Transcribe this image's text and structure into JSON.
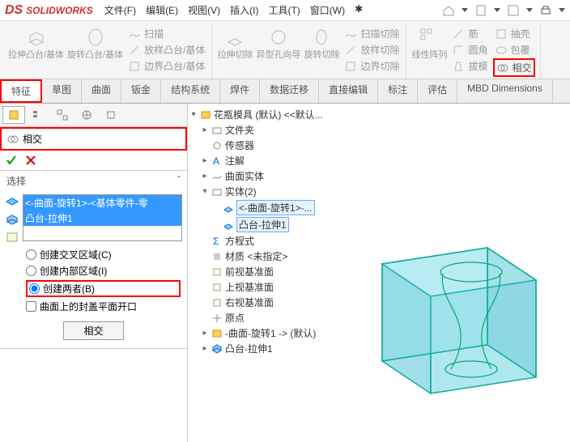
{
  "app": {
    "name": "SOLIDWORKS"
  },
  "menu": [
    "文件(F)",
    "编辑(E)",
    "视图(V)",
    "插入(I)",
    "工具(T)",
    "窗口(W)"
  ],
  "ribbon": {
    "group1_big": [
      "拉伸凸台/基体",
      "旋转凸台/基体"
    ],
    "group1_small": [
      "扫描",
      "放样凸台/基体",
      "边界凸台/基体"
    ],
    "group2_big": [
      "拉伸切除",
      "异型孔向导",
      "旋转切除"
    ],
    "group2_small": [
      "扫描切除",
      "放样切除",
      "边界切除"
    ],
    "group3_big": [
      "线性阵列"
    ],
    "group3_small": [
      "筋",
      "圆角",
      "拔模"
    ],
    "group4_small": [
      "抽壳",
      "包覆",
      "相交"
    ]
  },
  "tabs": [
    "特征",
    "草图",
    "曲面",
    "钣金",
    "结构系统",
    "焊件",
    "数据迁移",
    "直接编辑",
    "标注",
    "评估",
    "MBD Dimensions"
  ],
  "cmd": {
    "title": "相交",
    "select_label": "选择",
    "list": [
      "<-曲面-旋转1>-<基体零件-零",
      "凸台-拉伸1"
    ],
    "radios": {
      "r1": "创建交叉区域(C)",
      "r2": "创建内部区域(I)",
      "r3": "创建两者(B)"
    },
    "chk": "曲面上的封盖平面开口",
    "btn": "相交"
  },
  "tree": {
    "root": "花瓶模具 (默认) <<默认...",
    "n1": "文件夹",
    "n2": "传感器",
    "n3": "注解",
    "n4": "曲面实体",
    "n5": "实体(2)",
    "n5a": "<-曲面-旋转1>-...",
    "n5b": "凸台-拉伸1",
    "n6": "方程式",
    "n7": "材质 <未指定>",
    "n8": "前视基准面",
    "n9": "上视基准面",
    "n10": "右视基准面",
    "n11": "原点",
    "n12": "-曲面-旋转1 -> (默认)",
    "n13": "凸台-拉伸1"
  }
}
